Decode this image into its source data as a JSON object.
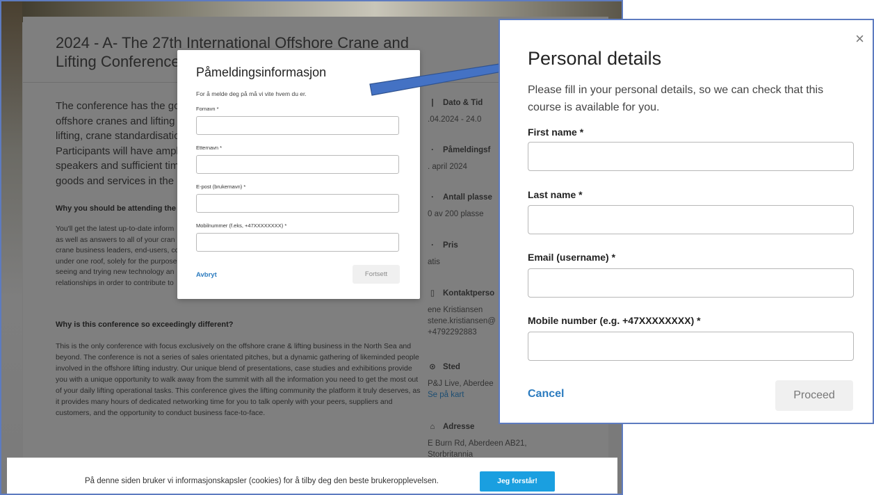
{
  "event_page": {
    "title": "2024 - A- The 27th International Offshore Crane and Lifting Conference",
    "intro": "The conference has the goal to\noffshore cranes and lifting tech\nlifting, crane standardisation a\nParticipants will have ample o\nspeakers and sufficient time to\ngoods and services in the exhi",
    "why_heading": "Why you should be attending the 27",
    "why_body": "You'll get the latest up-to-date inform\nas well as answers to all of your cran\ncrane business leaders, end-users, co\nunder one roof, solely for the purpose\nseeing and trying new technology an\nrelationships in order to contribute to",
    "diff_heading": "Why is this conference so exceedingly different?",
    "diff_body": "This is the only conference with focus exclusively on the offshore crane & lifting business in the North Sea and beyond. The conference is not a series of sales orientated pitches, but a dynamic gathering of likeminded people involved in the offshore lifting industry. Our unique blend of presentations, case studies and exhibitions provide you with a unique opportunity to walk away from the summit with all the information you need to get the most out of your daily lifting operational tasks. This conference gives the lifting community the platform it truly deserves, as it provides many hours of dedicated networking time for you to talk openly with your peers, suppliers and customers, and the opportunity to conduct business face-to-face.",
    "sidebar": {
      "date_label": "Dato & Tid",
      "date_value": ".04.2024 - 24.0",
      "deadline_label": "Påmeldingsf",
      "deadline_value": ". april 2024",
      "seats_label": "Antall plasse",
      "seats_value": "0 av 200 plasse",
      "price_label": "Pris",
      "price_value": "atis",
      "contact_label": "Kontaktperso",
      "contact_name": "ene Kristiansen",
      "contact_email": "stene.kristiansen@",
      "contact_phone": "+4792292883",
      "place_label": "Sted",
      "place_value": "P&J Live, Aberdee",
      "map_link": "Se på kart",
      "address_label": "Adresse",
      "address_value": "E Burn Rd, Aberdeen AB21,",
      "country_value": "Storbritannia"
    }
  },
  "small_modal": {
    "title": "Påmeldingsinformasjon",
    "subtitle": "For å melde deg på må vi vite hvem du er.",
    "first_name_label": "Fornavn *",
    "last_name_label": "Etternavn *",
    "email_label": "E-post (brukernavn) *",
    "mobile_label": "Mobilnummer (f.eks, +47XXXXXXXX) *",
    "cancel": "Avbryt",
    "proceed": "Fortsett"
  },
  "cookie_banner": {
    "text": "På denne siden bruker vi informasjonskapsler (cookies) for å tilby deg den beste brukeropplevelsen.",
    "button": "Jeg forstår!"
  },
  "right_modal": {
    "title": "Personal details",
    "subtitle": "Please fill in your personal details, so we can check that this course is available for you.",
    "first_name_label": "First name *",
    "last_name_label": "Last name *",
    "email_label": "Email (username) *",
    "mobile_label": "Mobile number (e.g. +47XXXXXXXX) *",
    "cancel": "Cancel",
    "proceed": "Proceed",
    "close_glyph": "×"
  },
  "colors": {
    "annotation_arrow": "#4472c4",
    "link_blue": "#2b7bbf",
    "cookie_button": "#1a9fe0"
  }
}
